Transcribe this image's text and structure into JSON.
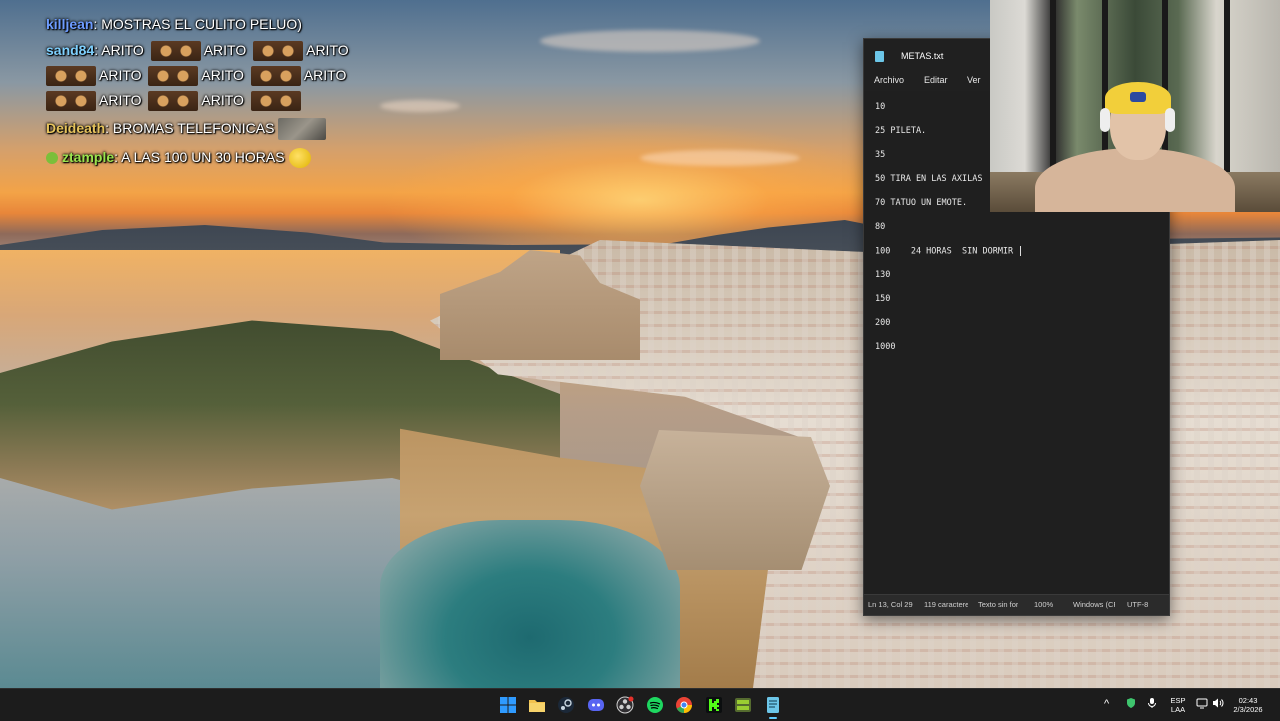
{
  "chat": {
    "lines": [
      {
        "user": "killjean",
        "sep": ": ",
        "text": "MOSTRAS EL CULITO PELUO)",
        "user_color": "#6d9cff"
      },
      {
        "user": "sand84",
        "sep": ": ",
        "text": "ARITO",
        "user_color": "#7fd1ff",
        "repeat": [
          "ARITO",
          "ARITO",
          "ARITO"
        ]
      },
      {
        "text_row2": [
          "ARITO",
          "ARITO",
          "ARITO"
        ]
      },
      {
        "text_row3": [
          "ARITO",
          "ARITO"
        ]
      },
      {
        "user": "Deideath",
        "sep": ": ",
        "text": "BROMAS TELEFONICAS",
        "user_color": "#e6c35c"
      },
      {
        "user": "ztample",
        "sep": ": ",
        "text": "A LAS 100 UN 30 HORAS",
        "user_color": "#9be34e"
      }
    ]
  },
  "notepad": {
    "title": "METAS.txt",
    "menu": [
      "Archivo",
      "Editar",
      "Ver"
    ],
    "lines": [
      "10",
      "25 PILETA.",
      "35",
      "50 TIRA EN LAS AXILAS",
      "70 TATUO UN EMOTE.",
      "80",
      "100    24 HORAS  SIN DORMIR ",
      "130",
      "150",
      "200",
      "1000"
    ],
    "status": {
      "position": "Ln 13, Col 29",
      "chars": "119 caracteres",
      "format": "Texto sin formato",
      "zoom": "100%",
      "eol": "Windows (CRLF)",
      "encoding": "UTF-8"
    }
  },
  "taskbar": {
    "apps": [
      {
        "name": "start",
        "color": "#2f9bff"
      },
      {
        "name": "file-explorer",
        "color": "#f2c14e"
      },
      {
        "name": "steam",
        "color": "#9fb6cc"
      },
      {
        "name": "discord",
        "color": "#5865f2"
      },
      {
        "name": "obs",
        "color": "#cfcfcf"
      },
      {
        "name": "spotify",
        "color": "#1ed760"
      },
      {
        "name": "chrome",
        "color": "#ea4335"
      },
      {
        "name": "kick",
        "color": "#53fc18"
      },
      {
        "name": "green-app",
        "color": "#6b8e23"
      },
      {
        "name": "notepad",
        "color": "#6cc6e8"
      }
    ],
    "tray": {
      "lang_line1": "ESP",
      "lang_line2": "LAA",
      "time": "02:43",
      "date": "2/3/2026"
    }
  }
}
